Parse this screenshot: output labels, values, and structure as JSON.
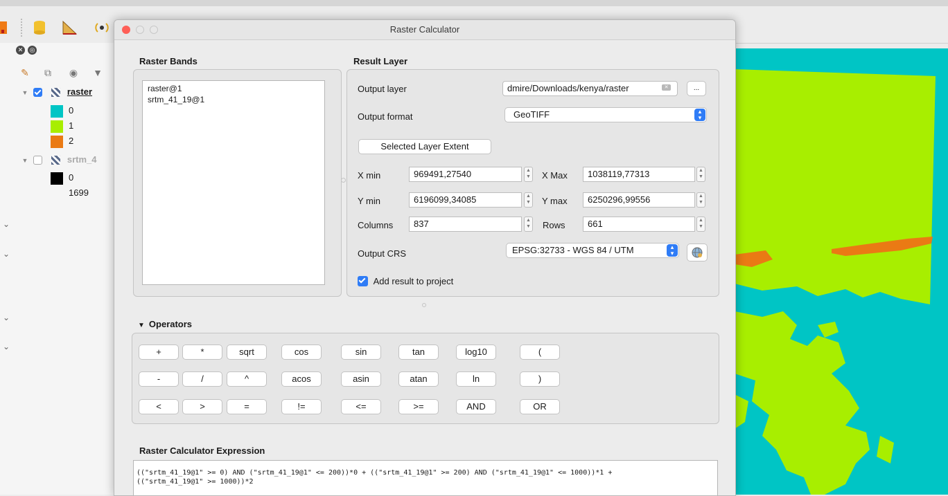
{
  "dialog": {
    "title": "Raster Calculator",
    "raster_bands": {
      "title": "Raster Bands",
      "items": [
        "raster@1",
        "srtm_41_19@1"
      ]
    },
    "result_layer": {
      "title": "Result Layer",
      "output_layer_label": "Output layer",
      "output_layer_value": "dmire/Downloads/kenya/raster",
      "browse_label": "...",
      "output_format_label": "Output format",
      "output_format_value": "GeoTIFF",
      "selected_extent_button": "Selected Layer Extent",
      "xmin_label": "X min",
      "xmin_value": "969491,27540",
      "xmax_label": "X Max",
      "xmax_value": "1038119,77313",
      "ymin_label": "Y min",
      "ymin_value": "6196099,34085",
      "ymax_label": "Y max",
      "ymax_value": "6250296,99556",
      "columns_label": "Columns",
      "columns_value": "837",
      "rows_label": "Rows",
      "rows_value": "661",
      "crs_label": "Output CRS",
      "crs_value": "EPSG:32733 - WGS 84 / UTM",
      "add_to_project_label": "Add result to project",
      "add_to_project_checked": true
    },
    "operators": {
      "title": "Operators",
      "rows": [
        [
          "+",
          "*",
          "sqrt",
          "cos",
          "sin",
          "tan",
          "log10",
          "("
        ],
        [
          "-",
          "/",
          "^",
          "acos",
          "asin",
          "atan",
          "ln",
          ")"
        ],
        [
          "<",
          ">",
          "=",
          "!=",
          "<=",
          ">=",
          "AND",
          "OR"
        ]
      ]
    },
    "expression": {
      "title": "Raster Calculator Expression",
      "text": "((\"srtm_41_19@1\" >= 0) AND (\"srtm_41_19@1\" <= 200))*0 + ((\"srtm_41_19@1\" >= 200) AND (\"srtm_41_19@1\" <= 1000))*1 +\n((\"srtm_41_19@1\" >= 1000))*2"
    }
  },
  "layers_panel": {
    "layers": [
      {
        "name": "raster",
        "checked": true,
        "classes": [
          {
            "value": "0",
            "color": "#00c5c5"
          },
          {
            "value": "1",
            "color": "#a8ee00"
          },
          {
            "value": "2",
            "color": "#ea7a14"
          }
        ]
      },
      {
        "name": "srtm_4",
        "checked": false,
        "classes": [
          {
            "value": "0",
            "color": "#000000"
          },
          {
            "value": "1699",
            "color": ""
          }
        ]
      }
    ]
  },
  "map": {
    "colors": {
      "class0": "#00c5c5",
      "class1": "#a8ee00",
      "class2": "#ea7a14"
    }
  },
  "colors": {
    "accent": "#2f7cf6",
    "close": "#fe5f57",
    "inactive_light": "#d0d0d0"
  }
}
